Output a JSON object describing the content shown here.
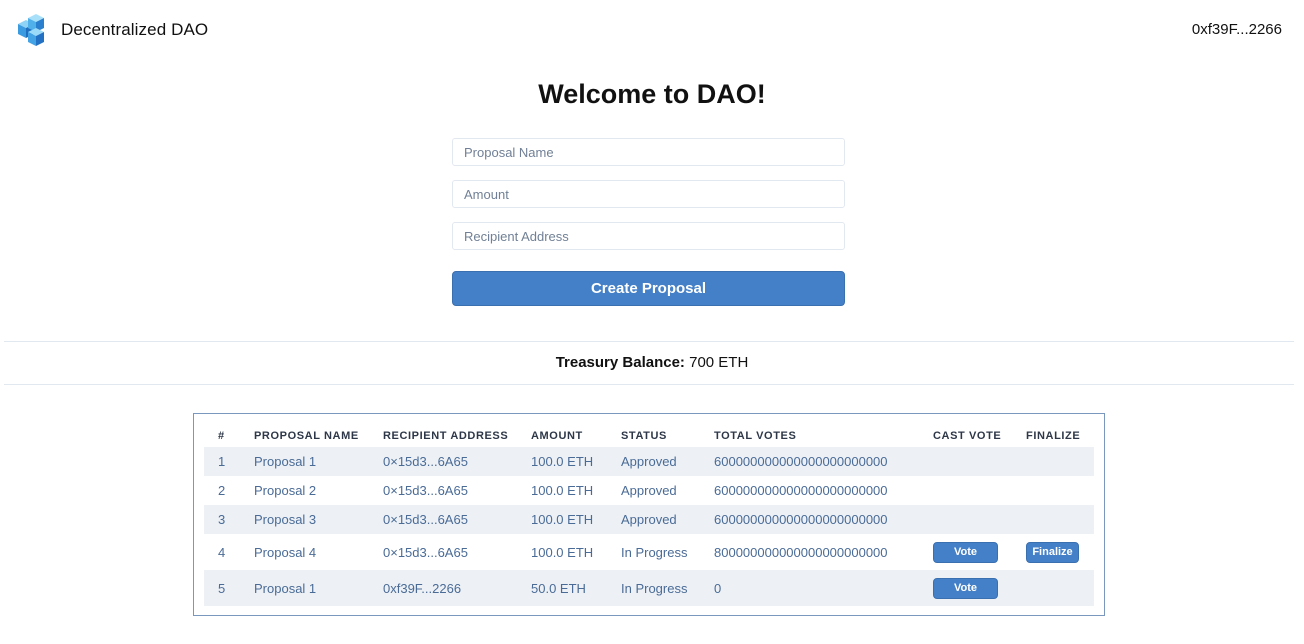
{
  "header": {
    "app_name": "Decentralized DAO",
    "account": "0xf39F...2266",
    "logo_icon": "blue-cube-logo-icon"
  },
  "main": {
    "title": "Welcome to DAO!",
    "form": {
      "proposal_name_placeholder": "Proposal Name",
      "amount_placeholder": "Amount",
      "recipient_placeholder": "Recipient Address",
      "submit_label": "Create Proposal"
    },
    "treasury": {
      "label": "Treasury Balance:",
      "value": "700 ETH"
    }
  },
  "table": {
    "columns": [
      "#",
      "PROPOSAL NAME",
      "RECIPIENT ADDRESS",
      "AMOUNT",
      "STATUS",
      "TOTAL VOTES",
      "CAST VOTE",
      "FINALIZE"
    ],
    "rows": [
      {
        "id": "1",
        "name": "Proposal 1",
        "recipient": "0×15d3...6A65",
        "amount": "100.0 ETH",
        "status": "Approved",
        "votes": "600000000000000000000000",
        "vote_label": "",
        "finalize_label": ""
      },
      {
        "id": "2",
        "name": "Proposal 2",
        "recipient": "0×15d3...6A65",
        "amount": "100.0 ETH",
        "status": "Approved",
        "votes": "600000000000000000000000",
        "vote_label": "",
        "finalize_label": ""
      },
      {
        "id": "3",
        "name": "Proposal 3",
        "recipient": "0×15d3...6A65",
        "amount": "100.0 ETH",
        "status": "Approved",
        "votes": "600000000000000000000000",
        "vote_label": "",
        "finalize_label": ""
      },
      {
        "id": "4",
        "name": "Proposal 4",
        "recipient": "0×15d3...6A65",
        "amount": "100.0 ETH",
        "status": "In Progress",
        "votes": "800000000000000000000000",
        "vote_label": "Vote",
        "finalize_label": "Finalize"
      },
      {
        "id": "5",
        "name": "Proposal 1",
        "recipient": "0xf39F...2266",
        "amount": "50.0 ETH",
        "status": "In Progress",
        "votes": "0",
        "vote_label": "Vote",
        "finalize_label": ""
      }
    ]
  },
  "colors": {
    "accent": "#4480c8",
    "row_stripe": "#edf1f6",
    "cell_text": "#4a6b96",
    "table_border": "#7a98bd"
  }
}
